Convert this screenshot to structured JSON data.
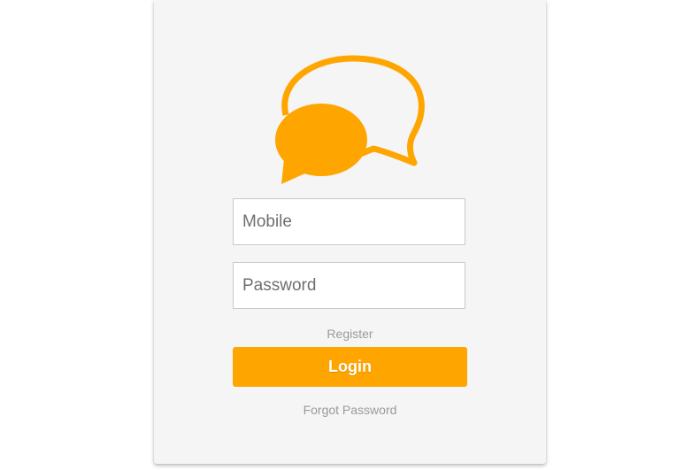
{
  "logo": {
    "icon": "chat-bubbles-icon",
    "color": "#ffa500"
  },
  "form": {
    "mobile_placeholder": "Mobile",
    "password_placeholder": "Password",
    "register_label": "Register",
    "login_label": "Login",
    "forgot_label": "Forgot Password"
  },
  "colors": {
    "accent": "#ffa500",
    "card_background": "#f5f5f5",
    "link_text": "#9a9a9a"
  }
}
